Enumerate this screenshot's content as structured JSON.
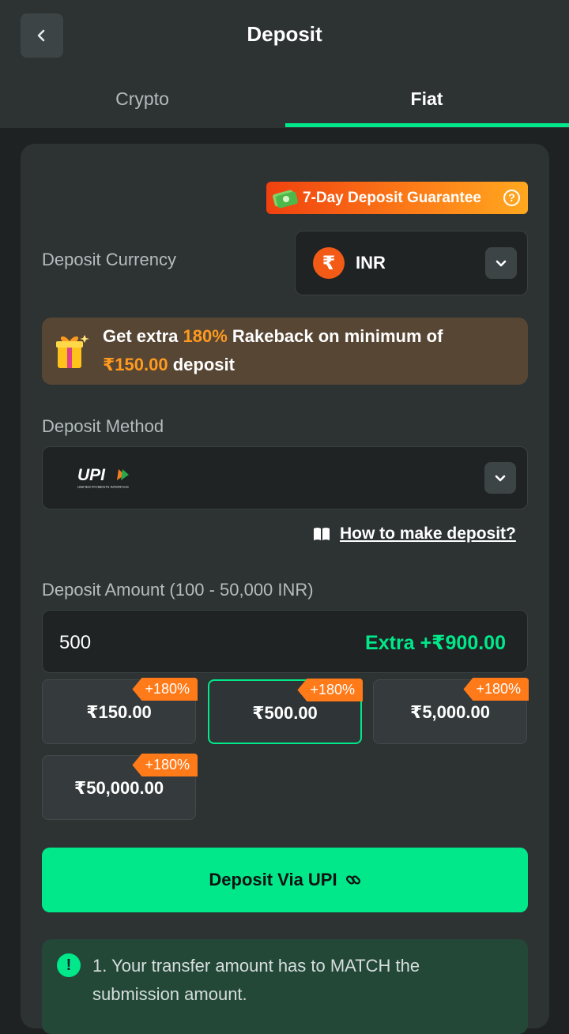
{
  "header": {
    "title": "Deposit",
    "back_icon": "chevron-left-icon"
  },
  "tabs": [
    {
      "label": "Crypto",
      "active": false
    },
    {
      "label": "Fiat",
      "active": true
    }
  ],
  "guarantee": {
    "label": "7-Day Deposit Guarantee",
    "help_icon": "question-circle-icon"
  },
  "currency": {
    "label": "Deposit Currency",
    "symbol": "₹",
    "value": "INR"
  },
  "promo": {
    "p1": "Get extra ",
    "percent": "180%",
    "p2": " Rakeback on minimum of",
    "min": "₹150.00",
    "p3": " deposit"
  },
  "method": {
    "label": "Deposit Method",
    "value": "UPI",
    "logo_caption": "UNIFIED PAYMENTS INTERFACE"
  },
  "howto": {
    "label": "How to make deposit?"
  },
  "amount": {
    "label": "Deposit Amount (100 - 50,000 INR)",
    "value": "500",
    "extra": "Extra +₹900.00"
  },
  "presets": [
    {
      "value": "₹150.00",
      "bonus": "+180%",
      "selected": false
    },
    {
      "value": "₹500.00",
      "bonus": "+180%",
      "selected": true
    },
    {
      "value": "₹5,000.00",
      "bonus": "+180%",
      "selected": false
    },
    {
      "value": "₹50,000.00",
      "bonus": "+180%",
      "selected": false
    }
  ],
  "submit": {
    "label": "Deposit Via UPI"
  },
  "info": {
    "text": "1. Your transfer amount has to MATCH the submission amount."
  },
  "colors": {
    "accent": "#00e88a",
    "orange": "#ff7a18",
    "bg": "#1f2222",
    "card": "#2d3233"
  }
}
